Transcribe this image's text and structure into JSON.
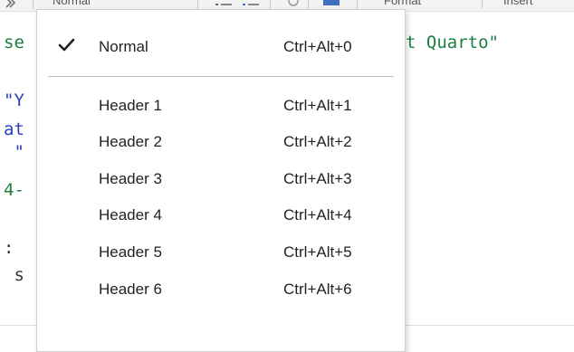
{
  "toolbar": {
    "items": [
      {
        "label": "Normal"
      },
      {
        "label": "Format"
      },
      {
        "label": "Insert"
      }
    ],
    "icons": [
      "bullet-list-icon",
      "numbered-list-icon",
      "link-icon",
      "image-icon"
    ]
  },
  "editor": {
    "lines": [
      {
        "text": "se",
        "continuation": "t Quarto\""
      },
      {
        "text": "\"Y"
      },
      {
        "text": "at"
      },
      {
        "text": " \""
      },
      {
        "text": "4-"
      },
      {
        "text": ":"
      },
      {
        "text": " s"
      }
    ],
    "colors": {
      "string": "#1d7f3e",
      "keyword": "#2a3fb8",
      "text": "#333333"
    }
  },
  "menu": {
    "selected": "Normal",
    "items": [
      {
        "label": "Normal",
        "shortcut": "Ctrl+Alt+0",
        "checked": true
      },
      {
        "label": "Header 1",
        "shortcut": "Ctrl+Alt+1",
        "checked": false
      },
      {
        "label": "Header 2",
        "shortcut": "Ctrl+Alt+2",
        "checked": false
      },
      {
        "label": "Header 3",
        "shortcut": "Ctrl+Alt+3",
        "checked": false
      },
      {
        "label": "Header 4",
        "shortcut": "Ctrl+Alt+4",
        "checked": false
      },
      {
        "label": "Header 5",
        "shortcut": "Ctrl+Alt+5",
        "checked": false
      },
      {
        "label": "Header 6",
        "shortcut": "Ctrl+Alt+6",
        "checked": false
      }
    ]
  }
}
